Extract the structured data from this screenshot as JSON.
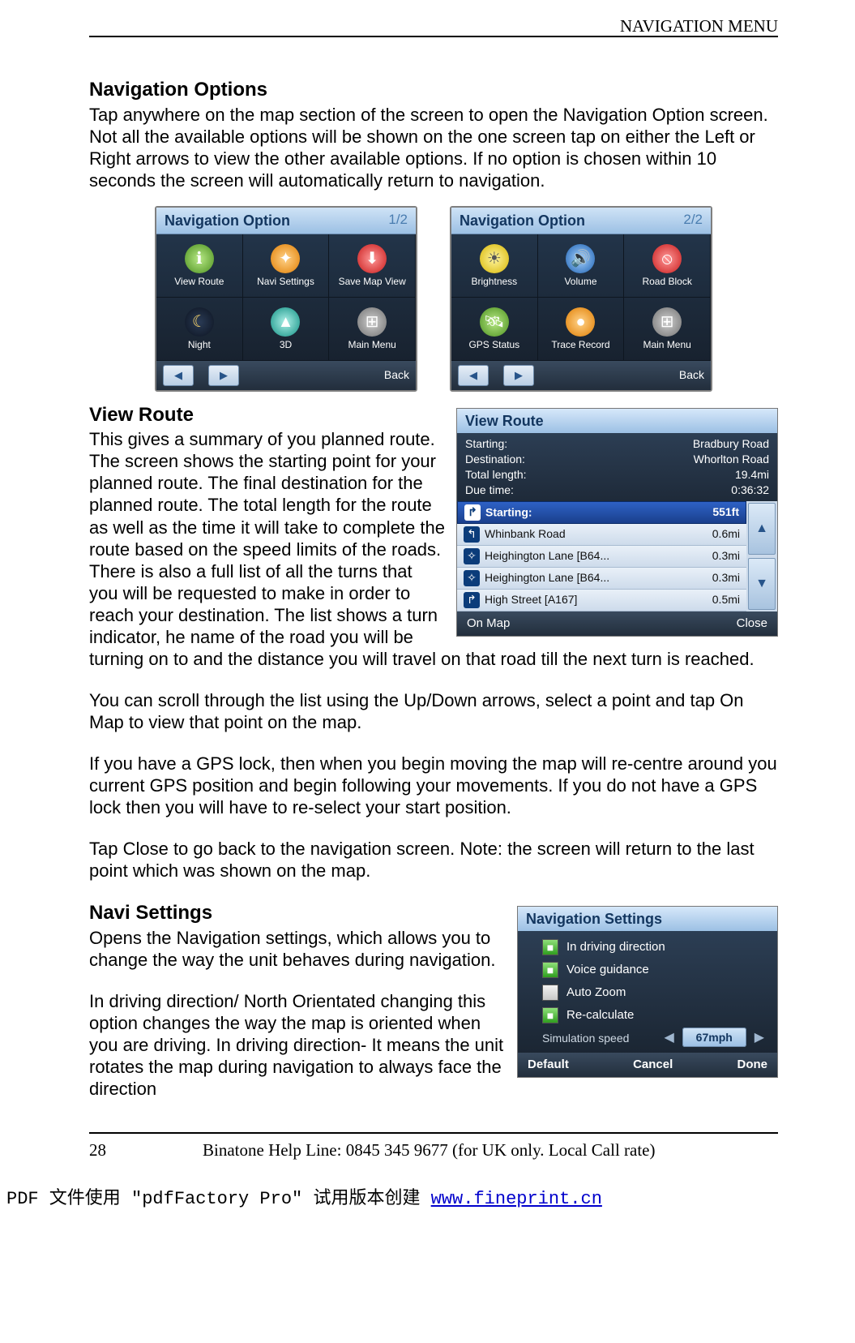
{
  "header": {
    "section_title": "NAVIGATION MENU"
  },
  "footer": {
    "page_number": "28",
    "helpline": "Binatone Help Line: 0845 345 9677 (for UK only. Local Call rate)"
  },
  "pdf_watermark": {
    "prefix": "PDF 文件使用 \"pdfFactory Pro\" 试用版本创建 ",
    "link_text": "www.fineprint.cn"
  },
  "section_nav_options": {
    "heading": "Navigation Options",
    "para": "Tap anywhere on the map section of the screen to open the Navigation Option screen. Not all the available options will be shown on the one screen tap on either the Left or Right arrows to view the other available options. If no option is chosen within 10 seconds the screen will automatically return to navigation."
  },
  "nav_option_screens": [
    {
      "title": "Navigation Option",
      "page_indicator": "1/2",
      "cells": [
        {
          "label": "View Route",
          "icon": "ℹ",
          "cls": "ic-green"
        },
        {
          "label": "Navi Settings",
          "icon": "✦",
          "cls": "ic-orange"
        },
        {
          "label": "Save Map View",
          "icon": "⬇",
          "cls": "ic-red"
        },
        {
          "label": "Night",
          "icon": "☾",
          "cls": "ic-moon"
        },
        {
          "label": "3D",
          "icon": "▲",
          "cls": "ic-teal"
        },
        {
          "label": "Main Menu",
          "icon": "⊞",
          "cls": "ic-gray"
        }
      ],
      "back": "Back"
    },
    {
      "title": "Navigation Option",
      "page_indicator": "2/2",
      "cells": [
        {
          "label": "Brightness",
          "icon": "☀",
          "cls": "ic-yellow"
        },
        {
          "label": "Volume",
          "icon": "🔊",
          "cls": "ic-blue"
        },
        {
          "label": "Road Block",
          "icon": "⦸",
          "cls": "ic-red"
        },
        {
          "label": "GPS Status",
          "icon": "🛰",
          "cls": "ic-green"
        },
        {
          "label": "Trace Record",
          "icon": "●",
          "cls": "ic-orange"
        },
        {
          "label": "Main Menu",
          "icon": "⊞",
          "cls": "ic-gray"
        }
      ],
      "back": "Back"
    }
  ],
  "section_view_route": {
    "heading": "View Route",
    "para1": "This gives a summary of you planned route. The screen shows the starting point for your planned route. The final destination for the planned route. The total length for the route as well as the time it will take to complete the route based on the speed limits of the roads.",
    "para2": "There is also a full list of all the turns that you will be requested to make in order to reach your destination. The list shows a turn indicator, he name of the road you will be turning on to and the distance you will travel on that road till the next turn is reached.",
    "para3": "You can scroll through the list using the Up/Down arrows, select a point and tap On Map to view that point on the map.",
    "para4": "If you have a GPS lock, then when you begin moving the map will re-centre around you current GPS position and begin following your movements. If you do not have a GPS lock then you will have to re-select your start position.",
    "para5": "Tap Close to go back to the navigation screen. Note: the screen will return to the last point which was shown on the map."
  },
  "view_route_screen": {
    "title": "View Route",
    "summary": {
      "starting_label": "Starting:",
      "starting_value": "Bradbury Road",
      "dest_label": "Destination:",
      "dest_value": "Whorlton Road",
      "length_label": "Total length:",
      "length_value": "19.4mi",
      "due_label": "Due time:",
      "due_value": "0:36:32"
    },
    "selected": {
      "icon": "↱",
      "label": "Starting:",
      "dist": "551ft"
    },
    "rows": [
      {
        "icon": "↰",
        "name": "Whinbank Road",
        "dist": "0.6mi"
      },
      {
        "icon": "✧",
        "name": "Heighington Lane [B64...",
        "dist": "0.3mi"
      },
      {
        "icon": "✧",
        "name": "Heighington Lane [B64...",
        "dist": "0.3mi"
      },
      {
        "icon": "↱",
        "name": "High Street [A167]",
        "dist": "0.5mi"
      }
    ],
    "footer": {
      "on_map": "On Map",
      "close": "Close"
    }
  },
  "section_navi_settings": {
    "heading": "Navi Settings",
    "para1": "Opens the Navigation settings, which allows you to change the way the unit behaves during navigation.",
    "para2": "In driving direction/ North Orientated changing this option changes the way the map is oriented when you are driving. In driving direction- It means the unit rotates the map during navigation to always face the direction"
  },
  "navi_settings_screen": {
    "title": "Navigation Settings",
    "items": [
      {
        "label": "In driving direction",
        "checked": true
      },
      {
        "label": "Voice guidance",
        "checked": true
      },
      {
        "label": "Auto Zoom",
        "checked": false
      },
      {
        "label": "Re-calculate",
        "checked": true
      }
    ],
    "sim": {
      "label": "Simulation speed",
      "value": "67mph"
    },
    "footer": {
      "default": "Default",
      "cancel": "Cancel",
      "done": "Done"
    }
  }
}
